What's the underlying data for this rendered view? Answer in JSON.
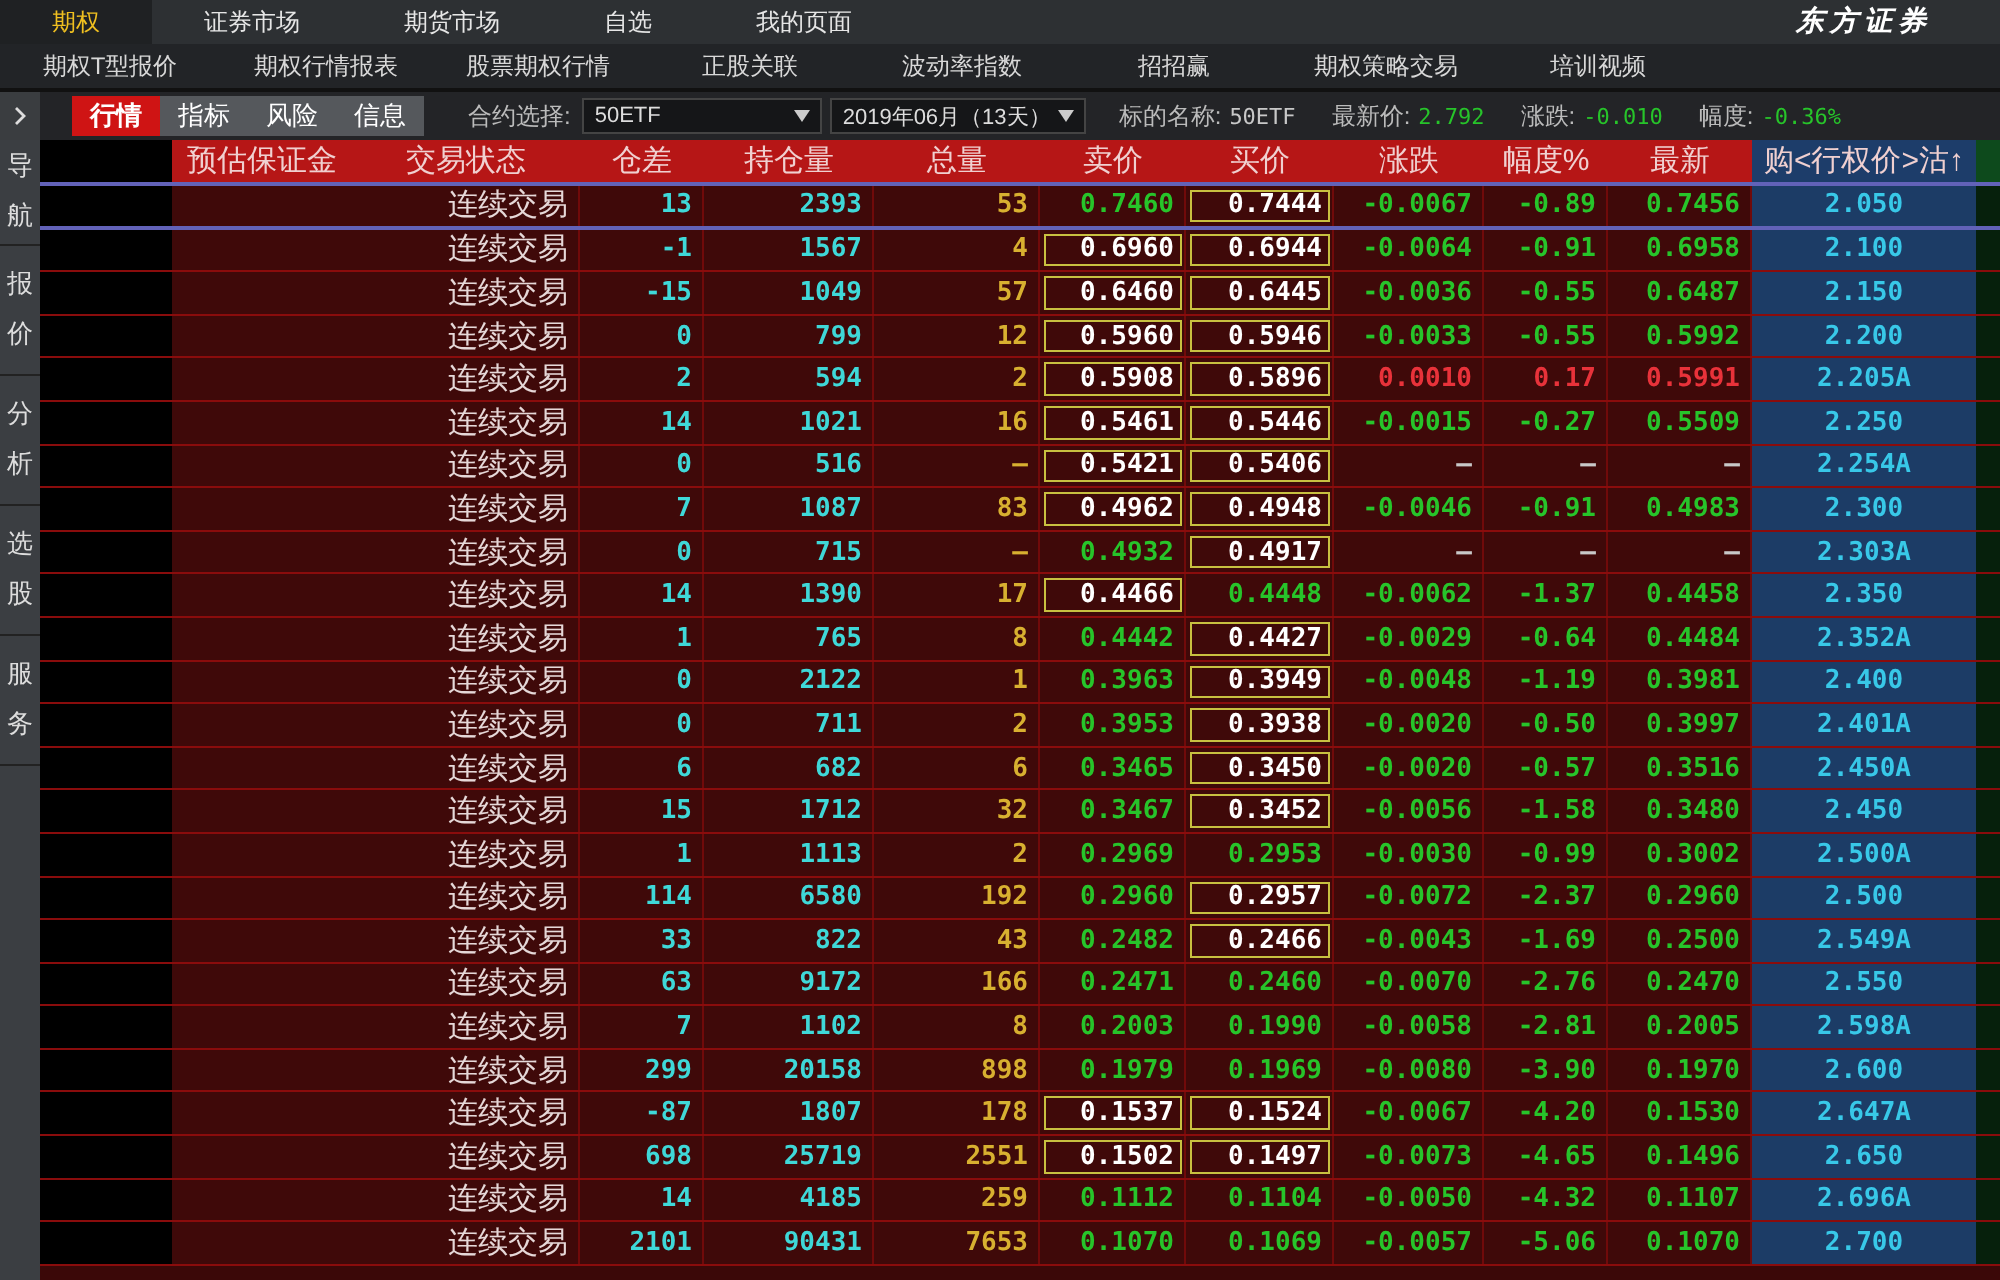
{
  "top_menu": [
    {
      "label": "期权",
      "selected": true
    },
    {
      "label": "证券市场",
      "selected": false
    },
    {
      "label": "期货市场",
      "selected": false
    },
    {
      "label": "自选",
      "selected": false
    },
    {
      "label": "我的页面",
      "selected": false
    }
  ],
  "brand": "东方证券",
  "sub_menu": [
    "期权T型报价",
    "期权行情报表",
    "股票期权行情",
    "正股关联",
    "波动率指数",
    "招招赢",
    "期权策略交易",
    "培训视频"
  ],
  "view_tabs": [
    {
      "label": "行情",
      "selected": true
    },
    {
      "label": "指标",
      "selected": false
    },
    {
      "label": "风险",
      "selected": false
    },
    {
      "label": "信息",
      "selected": false
    }
  ],
  "contract": {
    "label": "合约选择:",
    "value": "50ETF"
  },
  "month": {
    "value": "2019年06月（13天）"
  },
  "underlying": [
    {
      "label": "标的名称:",
      "value": "50ETF",
      "color": "#c8c8c8"
    },
    {
      "label": "最新价:",
      "value": "2.792",
      "color": "#27c42a"
    },
    {
      "label": "涨跌:",
      "value": "-0.010",
      "color": "#27c42a"
    },
    {
      "label": "幅度:",
      "value": "-0.36%",
      "color": "#27c42a"
    }
  ],
  "sidebar": [
    "导航",
    "报价",
    "分析",
    "选股",
    "服务"
  ],
  "columns": [
    "预估保证金",
    "交易状态",
    "仓差",
    "持仓量",
    "总量",
    "卖价",
    "买价",
    "涨跌",
    "幅度%",
    "最新",
    "购<行权价>沽↑"
  ],
  "rows": [
    {
      "selected": true,
      "status": "连续交易",
      "diff": "13",
      "oi": "2393",
      "vol": "53",
      "ask": "0.7460",
      "ask_boxed": false,
      "bid": "0.7444",
      "bid_boxed": true,
      "color": "#27c42a",
      "chg": "-0.0067",
      "pct": "-0.89",
      "last": "0.7456",
      "strike": "2.050"
    },
    {
      "selected": false,
      "status": "连续交易",
      "diff": "-1",
      "oi": "1567",
      "vol": "4",
      "ask": "0.6960",
      "ask_boxed": true,
      "bid": "0.6944",
      "bid_boxed": true,
      "color": "#27c42a",
      "chg": "-0.0064",
      "pct": "-0.91",
      "last": "0.6958",
      "strike": "2.100"
    },
    {
      "selected": false,
      "status": "连续交易",
      "diff": "-15",
      "oi": "1049",
      "vol": "57",
      "ask": "0.6460",
      "ask_boxed": true,
      "bid": "0.6445",
      "bid_boxed": true,
      "color": "#27c42a",
      "chg": "-0.0036",
      "pct": "-0.55",
      "last": "0.6487",
      "strike": "2.150"
    },
    {
      "selected": false,
      "status": "连续交易",
      "diff": "0",
      "oi": "799",
      "vol": "12",
      "ask": "0.5960",
      "ask_boxed": true,
      "bid": "0.5946",
      "bid_boxed": true,
      "color": "#27c42a",
      "chg": "-0.0033",
      "pct": "-0.55",
      "last": "0.5992",
      "strike": "2.200"
    },
    {
      "selected": false,
      "status": "连续交易",
      "diff": "2",
      "oi": "594",
      "vol": "2",
      "ask": "0.5908",
      "ask_boxed": true,
      "bid": "0.5896",
      "bid_boxed": true,
      "color": "#e8323a",
      "chg": "0.0010",
      "pct": "0.17",
      "last": "0.5991",
      "strike": "2.205A"
    },
    {
      "selected": false,
      "status": "连续交易",
      "diff": "14",
      "oi": "1021",
      "vol": "16",
      "ask": "0.5461",
      "ask_boxed": true,
      "bid": "0.5446",
      "bid_boxed": true,
      "color": "#27c42a",
      "chg": "-0.0015",
      "pct": "-0.27",
      "last": "0.5509",
      "strike": "2.250"
    },
    {
      "selected": false,
      "status": "连续交易",
      "diff": "0",
      "oi": "516",
      "vol": "–",
      "ask": "0.5421",
      "ask_boxed": true,
      "bid": "0.5406",
      "bid_boxed": true,
      "color": "#c8c8c8",
      "chg": "–",
      "pct": "–",
      "last": "–",
      "strike": "2.254A"
    },
    {
      "selected": false,
      "status": "连续交易",
      "diff": "7",
      "oi": "1087",
      "vol": "83",
      "ask": "0.4962",
      "ask_boxed": true,
      "bid": "0.4948",
      "bid_boxed": true,
      "color": "#27c42a",
      "chg": "-0.0046",
      "pct": "-0.91",
      "last": "0.4983",
      "strike": "2.300"
    },
    {
      "selected": false,
      "status": "连续交易",
      "diff": "0",
      "oi": "715",
      "vol": "–",
      "ask": "0.4932",
      "ask_boxed": false,
      "bid": "0.4917",
      "bid_boxed": true,
      "color": "#c8c8c8",
      "chg": "–",
      "pct": "–",
      "last": "–",
      "strike": "2.303A"
    },
    {
      "selected": false,
      "status": "连续交易",
      "diff": "14",
      "oi": "1390",
      "vol": "17",
      "ask": "0.4466",
      "ask_boxed": true,
      "bid": "0.4448",
      "bid_boxed": false,
      "color": "#27c42a",
      "chg": "-0.0062",
      "pct": "-1.37",
      "last": "0.4458",
      "strike": "2.350"
    },
    {
      "selected": false,
      "status": "连续交易",
      "diff": "1",
      "oi": "765",
      "vol": "8",
      "ask": "0.4442",
      "ask_boxed": false,
      "bid": "0.4427",
      "bid_boxed": true,
      "color": "#27c42a",
      "chg": "-0.0029",
      "pct": "-0.64",
      "last": "0.4484",
      "strike": "2.352A"
    },
    {
      "selected": false,
      "status": "连续交易",
      "diff": "0",
      "oi": "2122",
      "vol": "1",
      "ask": "0.3963",
      "ask_boxed": false,
      "bid": "0.3949",
      "bid_boxed": true,
      "color": "#27c42a",
      "chg": "-0.0048",
      "pct": "-1.19",
      "last": "0.3981",
      "strike": "2.400"
    },
    {
      "selected": false,
      "status": "连续交易",
      "diff": "0",
      "oi": "711",
      "vol": "2",
      "ask": "0.3953",
      "ask_boxed": false,
      "bid": "0.3938",
      "bid_boxed": true,
      "color": "#27c42a",
      "chg": "-0.0020",
      "pct": "-0.50",
      "last": "0.3997",
      "strike": "2.401A"
    },
    {
      "selected": false,
      "status": "连续交易",
      "diff": "6",
      "oi": "682",
      "vol": "6",
      "ask": "0.3465",
      "ask_boxed": false,
      "bid": "0.3450",
      "bid_boxed": true,
      "color": "#27c42a",
      "chg": "-0.0020",
      "pct": "-0.57",
      "last": "0.3516",
      "strike": "2.450A"
    },
    {
      "selected": false,
      "status": "连续交易",
      "diff": "15",
      "oi": "1712",
      "vol": "32",
      "ask": "0.3467",
      "ask_boxed": false,
      "bid": "0.3452",
      "bid_boxed": true,
      "color": "#27c42a",
      "chg": "-0.0056",
      "pct": "-1.58",
      "last": "0.3480",
      "strike": "2.450"
    },
    {
      "selected": false,
      "status": "连续交易",
      "diff": "1",
      "oi": "1113",
      "vol": "2",
      "ask": "0.2969",
      "ask_boxed": false,
      "bid": "0.2953",
      "bid_boxed": false,
      "color": "#27c42a",
      "chg": "-0.0030",
      "pct": "-0.99",
      "last": "0.3002",
      "strike": "2.500A"
    },
    {
      "selected": false,
      "status": "连续交易",
      "diff": "114",
      "oi": "6580",
      "vol": "192",
      "ask": "0.2960",
      "ask_boxed": false,
      "bid": "0.2957",
      "bid_boxed": true,
      "color": "#27c42a",
      "chg": "-0.0072",
      "pct": "-2.37",
      "last": "0.2960",
      "strike": "2.500"
    },
    {
      "selected": false,
      "status": "连续交易",
      "diff": "33",
      "oi": "822",
      "vol": "43",
      "ask": "0.2482",
      "ask_boxed": false,
      "bid": "0.2466",
      "bid_boxed": true,
      "color": "#27c42a",
      "chg": "-0.0043",
      "pct": "-1.69",
      "last": "0.2500",
      "strike": "2.549A"
    },
    {
      "selected": false,
      "status": "连续交易",
      "diff": "63",
      "oi": "9172",
      "vol": "166",
      "ask": "0.2471",
      "ask_boxed": false,
      "bid": "0.2460",
      "bid_boxed": false,
      "color": "#27c42a",
      "chg": "-0.0070",
      "pct": "-2.76",
      "last": "0.2470",
      "strike": "2.550"
    },
    {
      "selected": false,
      "status": "连续交易",
      "diff": "7",
      "oi": "1102",
      "vol": "8",
      "ask": "0.2003",
      "ask_boxed": false,
      "bid": "0.1990",
      "bid_boxed": false,
      "color": "#27c42a",
      "chg": "-0.0058",
      "pct": "-2.81",
      "last": "0.2005",
      "strike": "2.598A"
    },
    {
      "selected": false,
      "status": "连续交易",
      "diff": "299",
      "oi": "20158",
      "vol": "898",
      "ask": "0.1979",
      "ask_boxed": false,
      "bid": "0.1969",
      "bid_boxed": false,
      "color": "#27c42a",
      "chg": "-0.0080",
      "pct": "-3.90",
      "last": "0.1970",
      "strike": "2.600"
    },
    {
      "selected": false,
      "status": "连续交易",
      "diff": "-87",
      "oi": "1807",
      "vol": "178",
      "ask": "0.1537",
      "ask_boxed": true,
      "bid": "0.1524",
      "bid_boxed": true,
      "color": "#27c42a",
      "chg": "-0.0067",
      "pct": "-4.20",
      "last": "0.1530",
      "strike": "2.647A"
    },
    {
      "selected": false,
      "status": "连续交易",
      "diff": "698",
      "oi": "25719",
      "vol": "2551",
      "ask": "0.1502",
      "ask_boxed": true,
      "bid": "0.1497",
      "bid_boxed": true,
      "color": "#27c42a",
      "chg": "-0.0073",
      "pct": "-4.65",
      "last": "0.1496",
      "strike": "2.650"
    },
    {
      "selected": false,
      "status": "连续交易",
      "diff": "14",
      "oi": "4185",
      "vol": "259",
      "ask": "0.1112",
      "ask_boxed": false,
      "bid": "0.1104",
      "bid_boxed": false,
      "color": "#27c42a",
      "chg": "-0.0050",
      "pct": "-4.32",
      "last": "0.1107",
      "strike": "2.696A"
    },
    {
      "selected": false,
      "status": "连续交易",
      "diff": "2101",
      "oi": "90431",
      "vol": "7653",
      "ask": "0.1070",
      "ask_boxed": false,
      "bid": "0.1069",
      "bid_boxed": false,
      "color": "#27c42a",
      "chg": "-0.0057",
      "pct": "-5.06",
      "last": "0.1070",
      "strike": "2.700"
    }
  ]
}
